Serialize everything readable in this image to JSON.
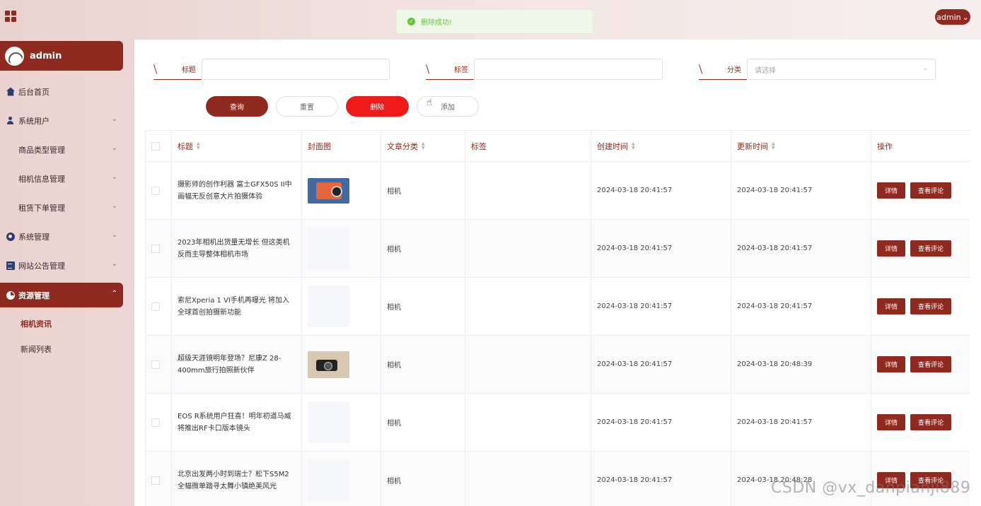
{
  "header": {
    "user_pill": "admin",
    "user_caret": "⌄",
    "toast": "删除成功!",
    "toast_icon": "✓"
  },
  "sidebar": {
    "user": "admin",
    "menu": [
      {
        "label": "后台首页",
        "icon": "home-icon"
      },
      {
        "label": "系统用户",
        "icon": "user-icon"
      },
      {
        "label": "商品类型管理",
        "icon": "grid-icon"
      },
      {
        "label": "相机信息管理",
        "icon": "grid-icon"
      },
      {
        "label": "租赁下单管理",
        "icon": "grid-icon"
      },
      {
        "label": "系统管理",
        "icon": "gear-icon"
      },
      {
        "label": "网站公告管理",
        "icon": "document-icon"
      },
      {
        "label": "资源管理",
        "icon": "pie-icon"
      }
    ],
    "submenu": [
      "相机资讯",
      "新闻列表"
    ],
    "caret_down": "⌄",
    "caret_up": "⌃"
  },
  "search": {
    "title_label": "标题",
    "tag_label": "标签",
    "category_label": "分类",
    "category_placeholder": "请选择",
    "select_arrow": "⌄"
  },
  "actions": {
    "query": "查询",
    "reset": "重置",
    "delete": "删除",
    "add": "添加"
  },
  "table": {
    "columns": [
      "标题",
      "封面图",
      "文章分类",
      "标签",
      "创建时间",
      "更新时间",
      "操作"
    ],
    "sort_up": "▲",
    "sort_down": "▼",
    "detail_label": "详情",
    "comment_label": "查看评论",
    "rows": [
      {
        "title": "摄影师的创作利器 富士GFX50S II中画幅无反创意大片拍摄体验",
        "category": "相机",
        "tag": "",
        "created": "2024-03-18 20:41:57",
        "updated": "2024-03-18 20:41:57",
        "cover": "camera-photo"
      },
      {
        "title": "2023年相机出货量无增长 但这类机反而主导整体相机市场",
        "category": "相机",
        "tag": "",
        "created": "2024-03-18 20:41:57",
        "updated": "2024-03-18 20:41:57",
        "cover": "blank"
      },
      {
        "title": "索尼Xperia 1 VI手机再曝光 将加入全球首创拍摄新功能",
        "category": "相机",
        "tag": "",
        "created": "2024-03-18 20:41:57",
        "updated": "2024-03-18 20:41:57",
        "cover": "blank"
      },
      {
        "title": "超级天涯镜明年登场？尼康Z 28-400mm旅行拍照新伙伴",
        "category": "相机",
        "tag": "",
        "created": "2024-03-18 20:41:57",
        "updated": "2024-03-18 20:48:39",
        "cover": "camera-photo"
      },
      {
        "title": "EOS R系统用户狂喜！明年初道马威将推出RF卡口版本镜头",
        "category": "相机",
        "tag": "",
        "created": "2024-03-18 20:41:57",
        "updated": "2024-03-18 20:41:57",
        "cover": "blank"
      },
      {
        "title": "北京出发两小时到瑞士？松下S5M2全幅微单踏寻太舞小镇绝美风光",
        "category": "相机",
        "tag": "",
        "created": "2024-03-18 20:41:57",
        "updated": "2024-03-18 20:48:28",
        "cover": "blank"
      }
    ]
  },
  "watermark": "CSDN @vx_danpianjî889"
}
